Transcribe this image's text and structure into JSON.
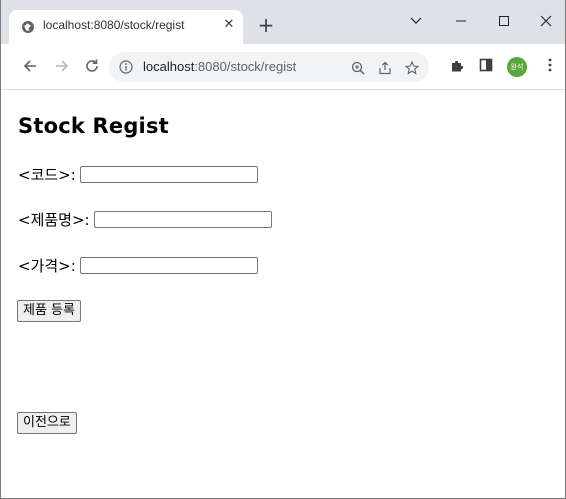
{
  "browser": {
    "tab_title": "localhost:8080/stock/regist",
    "url_host": "localhost",
    "url_path": ":8080/stock/regist",
    "avatar_text": "원석",
    "avatar_color": "#5aa73b"
  },
  "page": {
    "title": "Stock Regist",
    "fields": [
      {
        "label": "<코드>:",
        "value": ""
      },
      {
        "label": "<제품명>:",
        "value": ""
      },
      {
        "label": "<가격>:",
        "value": ""
      }
    ],
    "submit_label": "제품 등록",
    "back_label": "이전으로"
  }
}
